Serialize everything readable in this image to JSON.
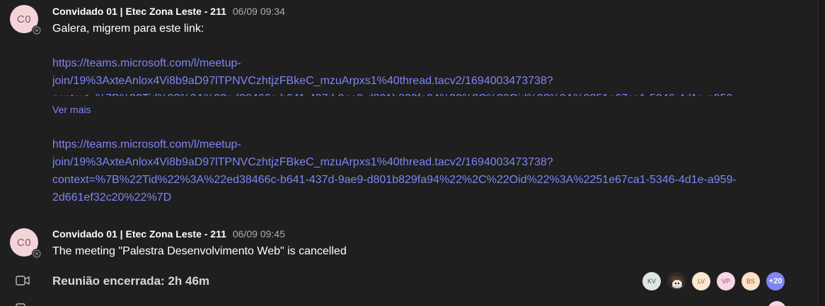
{
  "messages": [
    {
      "avatar_initials": "C0",
      "sender": "Convidado 01 | Etec Zona Leste - 211",
      "timestamp": "06/09 09:34",
      "text": "Galera, migrem para este link:",
      "collapsed_link_lines": [
        "https://teams.microsoft.com/l/meetup-",
        "join/19%3AxteAnlox4Vi8b9aD97lTPNVCzhtjzFBkeC_mzuArpxs1%40thread.tacv2/1694003473738?"
      ],
      "see_more_label": "Ver mais",
      "link_lines": [
        "https://teams.microsoft.com/l/meetup-",
        "join/19%3AxteAnlox4Vi8b9aD97lTPNVCzhtjzFBkeC_mzuArpxs1%40thread.tacv2/1694003473738?",
        "context=%7B%22Tid%22%3A%22ed38466c-b641-437d-9ae9-d801b829fa94%22%2C%22Oid%22%3A%2251e67ca1-5346-4d1e-a959-",
        "2d661ef32c20%22%7D"
      ]
    },
    {
      "avatar_initials": "C0",
      "sender": "Convidado 01 | Etec Zona Leste - 211",
      "timestamp": "06/09 09:45",
      "text": "The meeting \"Palestra Desenvolvimento Web\" is cancelled"
    }
  ],
  "meeting_ended": {
    "icon": "video-camera-icon",
    "label": "Reunião encerrada: 2h 46m",
    "participants": [
      {
        "initials": "KV",
        "color": "#dfe6e1"
      },
      {
        "initials": "",
        "color": "#2b2b2b"
      },
      {
        "initials": "LV",
        "color": "#fbe6cf"
      },
      {
        "initials": "VP",
        "color": "#f6d6e6"
      },
      {
        "initials": "BS",
        "color": "#fbe1c6"
      }
    ],
    "more_count": "+20"
  },
  "colors": {
    "background": "#1f1f1f",
    "link": "#7f85f5",
    "timestamp": "#adadad"
  }
}
